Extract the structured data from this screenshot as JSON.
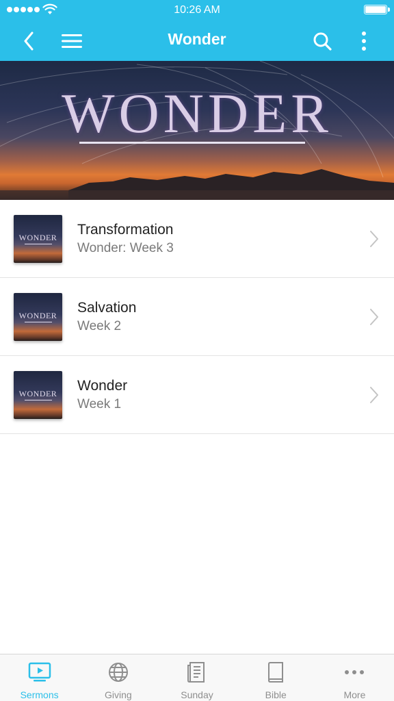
{
  "status_bar": {
    "time": "10:26 AM"
  },
  "header": {
    "title": "Wonder"
  },
  "banner": {
    "title": "WONDER"
  },
  "sermons": [
    {
      "title": "Transformation",
      "subtitle": "Wonder: Week 3",
      "thumb_text": "WONDER"
    },
    {
      "title": "Salvation",
      "subtitle": "Week 2",
      "thumb_text": "WONDER"
    },
    {
      "title": "Wonder",
      "subtitle": "Week 1",
      "thumb_text": "WONDER"
    }
  ],
  "tabs": [
    {
      "label": "Sermons",
      "icon": "tv-play-icon",
      "active": true
    },
    {
      "label": "Giving",
      "icon": "globe-icon",
      "active": false
    },
    {
      "label": "Sunday",
      "icon": "newspaper-icon",
      "active": false
    },
    {
      "label": "Bible",
      "icon": "book-icon",
      "active": false
    },
    {
      "label": "More",
      "icon": "more-dots-icon",
      "active": false
    }
  ],
  "colors": {
    "accent": "#2bbfe9",
    "tab_inactive": "#8e8e8e"
  }
}
